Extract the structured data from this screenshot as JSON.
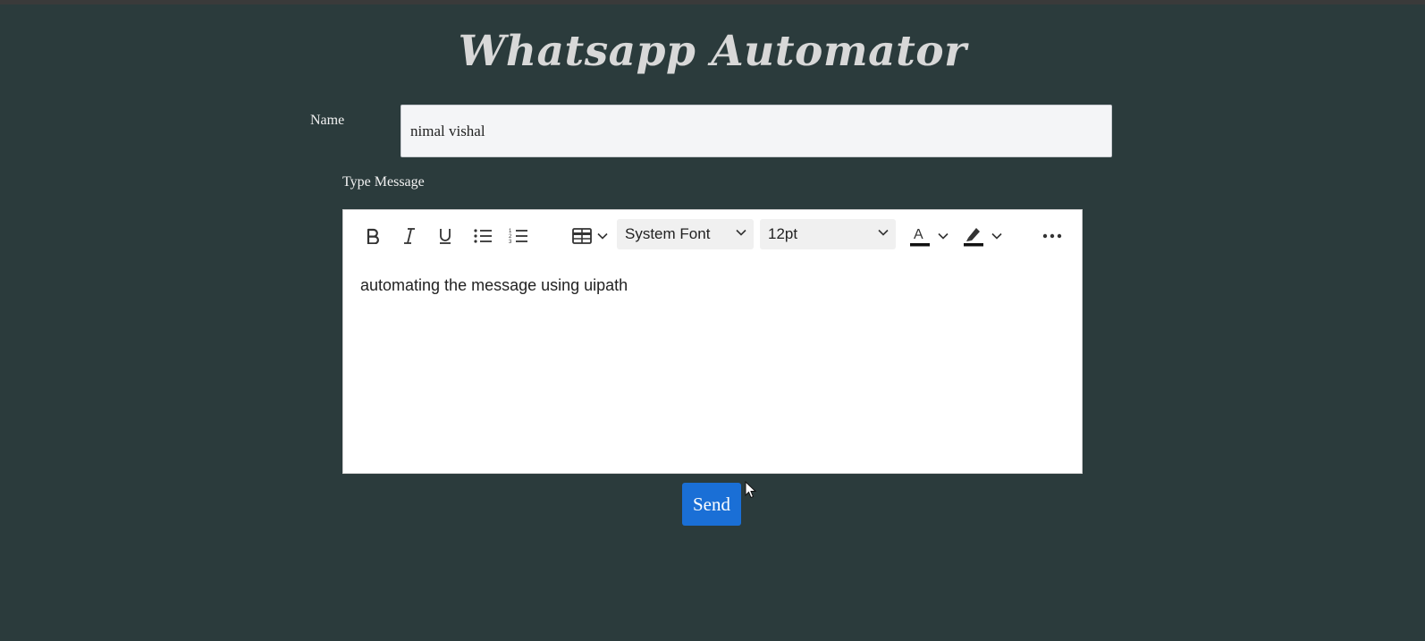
{
  "app": {
    "title": "Whatsapp Automator"
  },
  "form": {
    "name_label": "Name",
    "name_value": "nimal vishal",
    "message_label": "Type Message"
  },
  "editor": {
    "toolbar": {
      "bold_icon": "bold-icon",
      "italic_icon": "italic-icon",
      "underline_icon": "underline-icon",
      "bullet_list_icon": "bullet-list-icon",
      "numbered_list_icon": "numbered-list-icon",
      "table_icon": "table-icon",
      "font_family": "System Font",
      "font_size": "12pt",
      "text_color_icon": "text-color-icon",
      "highlight_icon": "highlight-icon",
      "more_icon": "more-icon"
    },
    "content": "automating the message using uipath"
  },
  "actions": {
    "send_label": "Send"
  },
  "colors": {
    "background": "#2b3b3c",
    "send_button": "#1a6fd6"
  }
}
